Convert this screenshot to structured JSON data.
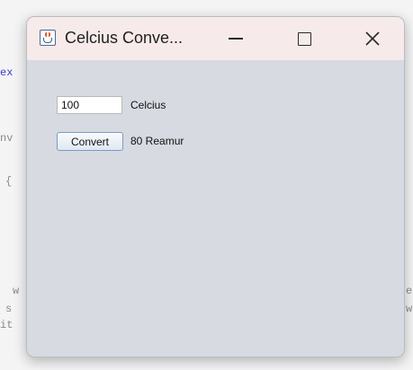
{
  "window": {
    "title": "Celcius Conve...",
    "controls": {
      "minimize": "minimize-icon",
      "maximize": "maximize-icon",
      "close": "close-icon"
    }
  },
  "form": {
    "input_value": "100",
    "unit_label": "Celcius",
    "convert_label": "Convert",
    "result_text": "80 Reamur"
  },
  "background_code": {
    "line1": "ex",
    "line2": "nv",
    "line3": "{",
    "line4": "w",
    "line5": "s",
    "line6": "it",
    "right1": "e",
    "right2": "w"
  }
}
